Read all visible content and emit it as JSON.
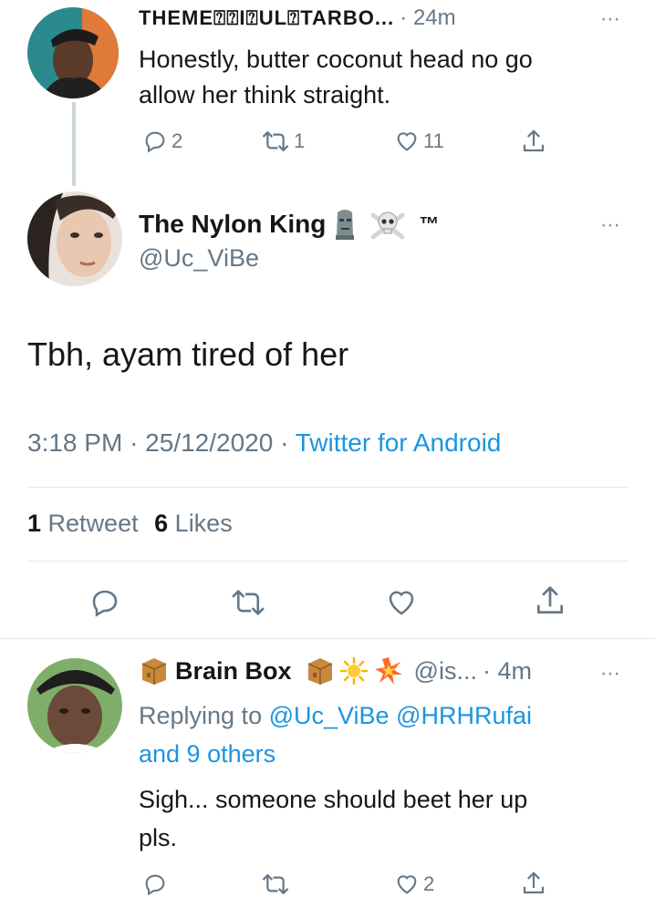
{
  "tweet1": {
    "display_name": "THEME⍰⍰I⍰UL⍰TARBO...",
    "time": "· 24m",
    "text_line1": "Honestly, butter coconut head no go",
    "text_line2": "allow her think straight.",
    "replies": "2",
    "retweets": "1",
    "likes": "11"
  },
  "main": {
    "display_name": "The Nylon King",
    "name_suffix": "™",
    "handle": "@Uc_ViBe",
    "text": "Tbh, ayam tired of her",
    "time": "3:18 PM",
    "date": "25/12/2020",
    "source": "Twitter for Android",
    "retweet_count": "1",
    "retweet_label": "Retweet",
    "like_count": "6",
    "like_label": "Likes"
  },
  "reply": {
    "display_name": "Brain Box",
    "handle": "@is...",
    "time": "· 4m",
    "replying_prefix": "Replying to",
    "replying_users": "@Uc_ViBe @HRHRufai",
    "replying_others": "and 9 others",
    "text_line1": "Sigh... someone should beet her up",
    "text_line2": "pls.",
    "likes": "2"
  },
  "colors": {
    "link": "#1b95e0",
    "muted": "#657786",
    "divider": "#e1e8ed"
  },
  "icons": [
    "reply-icon",
    "retweet-icon",
    "heart-icon",
    "share-icon",
    "more-icon"
  ]
}
